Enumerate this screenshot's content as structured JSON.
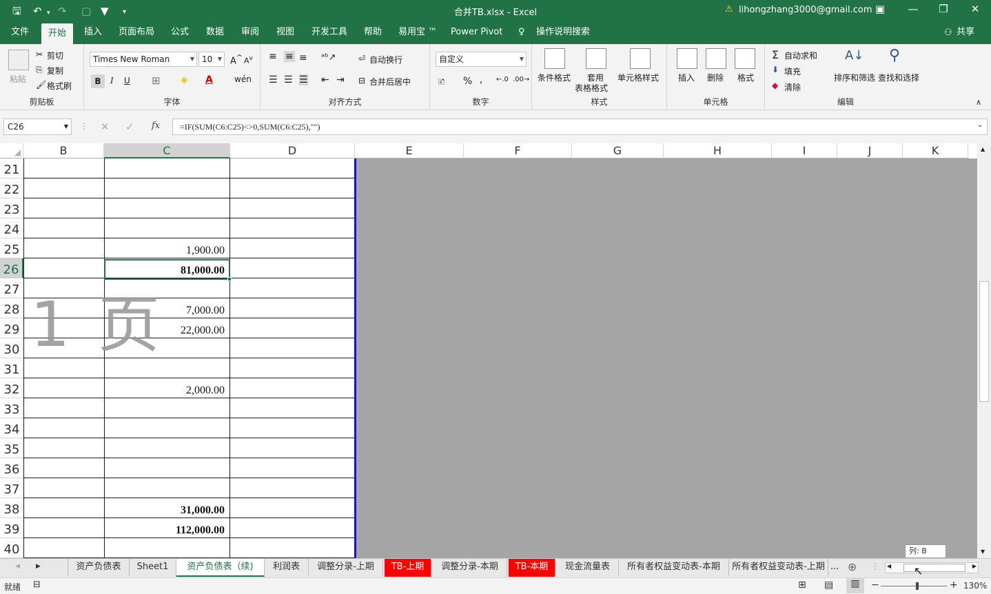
{
  "window": {
    "title": "合并TB.xlsx  -  Excel",
    "account": "lihongzhang3000@gmail.com",
    "warn_icon": "warning-icon"
  },
  "menu": {
    "tabs": [
      "文件",
      "开始",
      "插入",
      "页面布局",
      "公式",
      "数据",
      "审阅",
      "视图",
      "开发工具",
      "帮助",
      "易用宝 ™",
      "Power Pivot"
    ],
    "tell_me": "操作说明搜索",
    "share": "共享",
    "active_index": 1
  },
  "ribbon": {
    "clipboard": {
      "label": "剪贴板",
      "paste": "粘贴",
      "cut": "剪切",
      "copy": "复制",
      "format_painter": "格式刷"
    },
    "font": {
      "label": "字体",
      "name": "Times New Roman",
      "size": "10",
      "bold": "B",
      "italic": "I",
      "underline": "U"
    },
    "alignment": {
      "label": "对齐方式",
      "wrap": "自动换行",
      "merge": "合并后居中"
    },
    "number": {
      "label": "数字",
      "format": "自定义",
      "percent": "%",
      "comma": ","
    },
    "styles": {
      "label": "样式",
      "conditional": "条件格式",
      "table1": "套用",
      "table2": "表格格式",
      "cell_styles": "单元格样式"
    },
    "cells": {
      "label": "单元格",
      "insert": "插入",
      "delete": "删除",
      "format": "格式"
    },
    "editing": {
      "label": "编辑",
      "autosum": "自动求和",
      "fill": "填充",
      "clear": "清除",
      "sort": "排序和筛选",
      "find": "查找和选择"
    }
  },
  "formula_bar": {
    "name_box": "C26",
    "fx": "fx",
    "formula": "=IF(SUM(C6:C25)<>0,SUM(C6:C25),\"\")"
  },
  "grid": {
    "columns": [
      "B",
      "C",
      "D",
      "E",
      "F",
      "G",
      "H",
      "I",
      "J",
      "K"
    ],
    "selected_column": "C",
    "rows": [
      {
        "n": "21",
        "c": "",
        "bold": false
      },
      {
        "n": "22",
        "c": "",
        "bold": false
      },
      {
        "n": "23",
        "c": "",
        "bold": false
      },
      {
        "n": "24",
        "c": "",
        "bold": false
      },
      {
        "n": "25",
        "c": "1,900.00",
        "bold": false
      },
      {
        "n": "26",
        "c": "81,000.00",
        "bold": true
      },
      {
        "n": "27",
        "c": "",
        "bold": false
      },
      {
        "n": "28",
        "c": "7,000.00",
        "bold": false
      },
      {
        "n": "29",
        "c": "22,000.00",
        "bold": false
      },
      {
        "n": "30",
        "c": "",
        "bold": false
      },
      {
        "n": "31",
        "c": "",
        "bold": false
      },
      {
        "n": "32",
        "c": "2,000.00",
        "bold": false
      },
      {
        "n": "33",
        "c": "",
        "bold": false
      },
      {
        "n": "34",
        "c": "",
        "bold": false
      },
      {
        "n": "35",
        "c": "",
        "bold": false
      },
      {
        "n": "36",
        "c": "",
        "bold": false
      },
      {
        "n": "37",
        "c": "",
        "bold": false
      },
      {
        "n": "38",
        "c": "31,000.00",
        "bold": true
      },
      {
        "n": "39",
        "c": "112,000.00",
        "bold": true
      },
      {
        "n": "40",
        "c": "",
        "bold": false
      }
    ],
    "selected_row": "26",
    "watermark": "1 页"
  },
  "sheets": {
    "tabs": [
      {
        "label": "资产负债表",
        "style": "normal"
      },
      {
        "label": "Sheet1",
        "style": "normal"
      },
      {
        "label": "资产负债表（续)",
        "style": "active"
      },
      {
        "label": "利润表",
        "style": "normal"
      },
      {
        "label": "调整分录-上期",
        "style": "normal"
      },
      {
        "label": "TB-上期",
        "style": "red"
      },
      {
        "label": "调整分录-本期",
        "style": "normal"
      },
      {
        "label": "TB-本期",
        "style": "red"
      },
      {
        "label": "现金流量表",
        "style": "normal"
      },
      {
        "label": "所有者权益变动表-本期",
        "style": "normal"
      },
      {
        "label": "所有者权益变动表-上期",
        "style": "normal"
      }
    ],
    "more": "..."
  },
  "tooltip": "列: B",
  "status": {
    "ready": "就绪",
    "zoom": "130%"
  }
}
